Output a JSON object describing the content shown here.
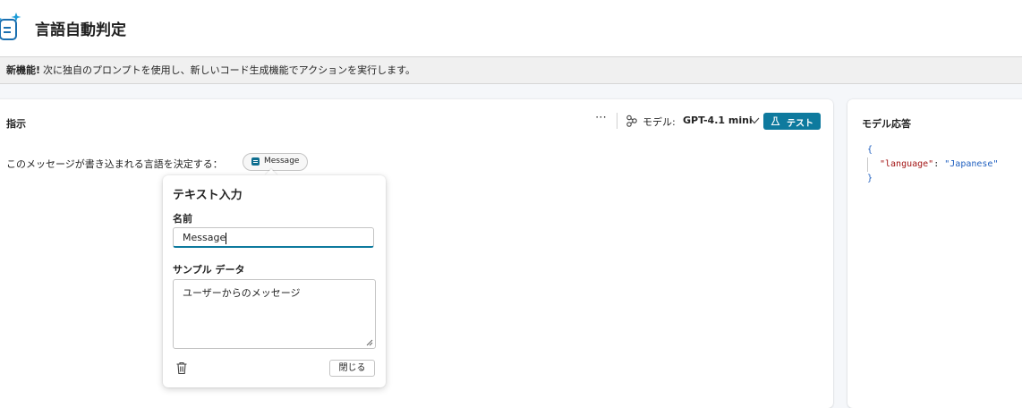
{
  "header": {
    "title": "言語自動判定",
    "icon": "ai-prompt-icon"
  },
  "banner": {
    "bold": "新機能!",
    "text": "次に独自のプロンプトを使用し、新しいコード生成機能でアクションを実行します。"
  },
  "instructions": {
    "title": "指示",
    "more": "⋯",
    "model_label": "モデル:",
    "model_value": "GPT-4.1 mini",
    "test_label": "テスト",
    "text": "このメッセージが書き込まれる言語を決定する：",
    "chip_label": "Message"
  },
  "popup": {
    "title": "テキスト入力",
    "name_label": "名前",
    "name_value": "Message",
    "sample_label": "サンプル データ",
    "sample_value": "ユーザーからのメッセージ",
    "close_label": "閉じる"
  },
  "response": {
    "title": "モデル応答",
    "open_brace": "{",
    "key": "\"language\"",
    "colon": ": ",
    "value": "\"Japanese\"",
    "close_brace": "}"
  },
  "colors": {
    "accent": "#0e7a9e",
    "chip_icon": "#0e6e8f"
  }
}
